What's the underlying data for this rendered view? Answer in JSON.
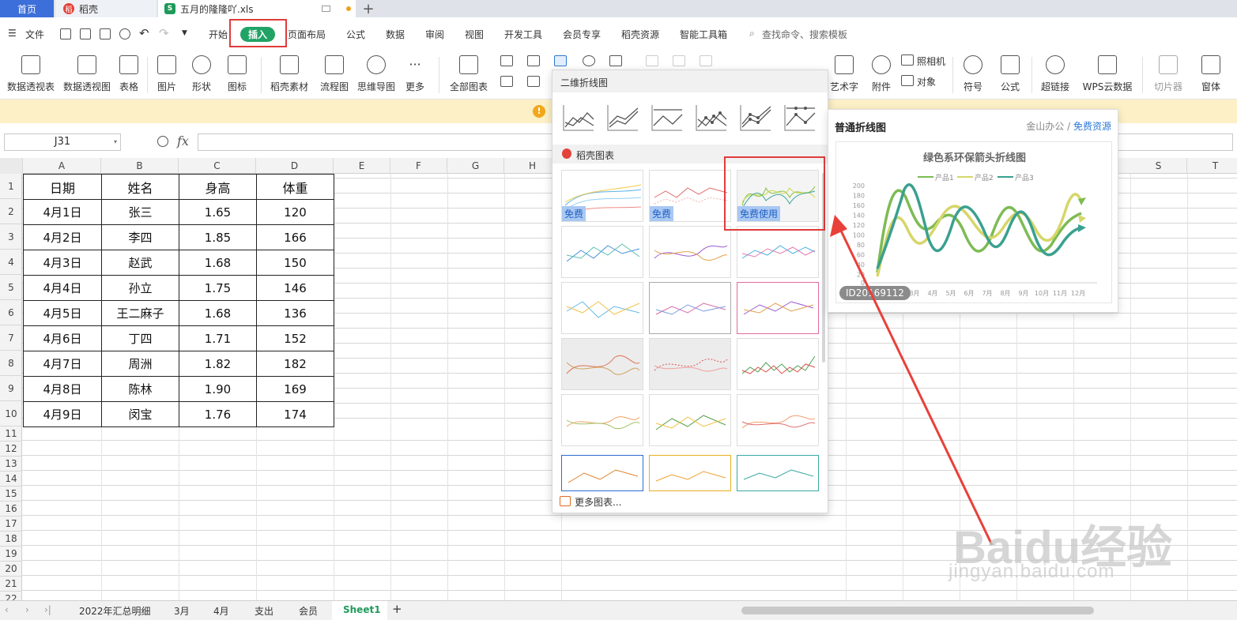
{
  "tabs": {
    "home": "首页",
    "docer": "稻壳",
    "file": "五月的隆隆吖.xls",
    "docer_logo": "稻",
    "xls_logo": "S",
    "new_tab": "+"
  },
  "menu": {
    "file": "文件",
    "items": [
      "开始",
      "插入",
      "页面布局",
      "公式",
      "数据",
      "审阅",
      "视图",
      "开发工具",
      "会员专享",
      "稻壳资源",
      "智能工具箱"
    ],
    "search": "查找命令、搜索模板"
  },
  "ribbon": {
    "buttons": [
      "数据透视表",
      "数据透视图",
      "表格",
      "图片",
      "形状",
      "图标",
      "稻壳素材",
      "流程图",
      "思维导图",
      "更多",
      "全部图表",
      "艺术字",
      "附件",
      "照相机",
      "对象",
      "符号",
      "公式",
      "超链接",
      "WPS云数据",
      "切片器",
      "窗体"
    ]
  },
  "formula": {
    "cell_ref": "J31",
    "fx": "fx"
  },
  "grid": {
    "columns": [
      "A",
      "B",
      "C",
      "D",
      "E",
      "F",
      "G",
      "H",
      "S",
      "T"
    ],
    "rows": [
      "1",
      "2",
      "3",
      "4",
      "5",
      "6",
      "7",
      "8",
      "9",
      "10",
      "11",
      "12",
      "13",
      "14",
      "15",
      "16",
      "17",
      "18",
      "19",
      "20",
      "21",
      "22"
    ],
    "table": {
      "headers": [
        "日期",
        "姓名",
        "身高",
        "体重"
      ],
      "rows": [
        [
          "4月1日",
          "张三",
          "1.65",
          "120"
        ],
        [
          "4月2日",
          "李四",
          "1.85",
          "166"
        ],
        [
          "4月3日",
          "赵武",
          "1.68",
          "150"
        ],
        [
          "4月4日",
          "孙立",
          "1.75",
          "146"
        ],
        [
          "4月5日",
          "王二麻子",
          "1.68",
          "136"
        ],
        [
          "4月6日",
          "丁四",
          "1.71",
          "152"
        ],
        [
          "4月7日",
          "周洲",
          "1.82",
          "182"
        ],
        [
          "4月8日",
          "陈林",
          "1.90",
          "169"
        ],
        [
          "4月9日",
          "闵宝",
          "1.76",
          "174"
        ]
      ]
    }
  },
  "sheets": {
    "tabs": [
      "2022年汇总明细",
      "3月",
      "4月",
      "支出",
      "会员",
      "Sheet1"
    ],
    "active": "Sheet1",
    "add": "+"
  },
  "dropdown": {
    "section_line": "二维折线图",
    "section_docer": "稻壳图表",
    "badge_free": "免费",
    "badge_free_use": "免费使用",
    "more_charts": "更多图表..."
  },
  "preview": {
    "title": "普通折线图",
    "source": "金山办公",
    "sep": "/",
    "free_resource": "免费资源",
    "id": "ID20169112",
    "chart_title": "绿色系环保箭头折线图",
    "legend": [
      "产品1",
      "产品2",
      "产品3"
    ],
    "yticks": [
      "200",
      "180",
      "160",
      "140",
      "120",
      "100",
      "80",
      "60",
      "40",
      "20",
      "0"
    ],
    "xticks": [
      "3月",
      "4月",
      "5月",
      "6月",
      "7月",
      "8月",
      "9月",
      "10月",
      "11月",
      "12月"
    ]
  },
  "watermark": {
    "logo": "Baidu经验",
    "url": "jingyan.baidu.com"
  },
  "colors": {
    "accent_green": "#21a366",
    "highlight_red": "#e23b3b",
    "tab_blue": "#3c6fd9"
  }
}
